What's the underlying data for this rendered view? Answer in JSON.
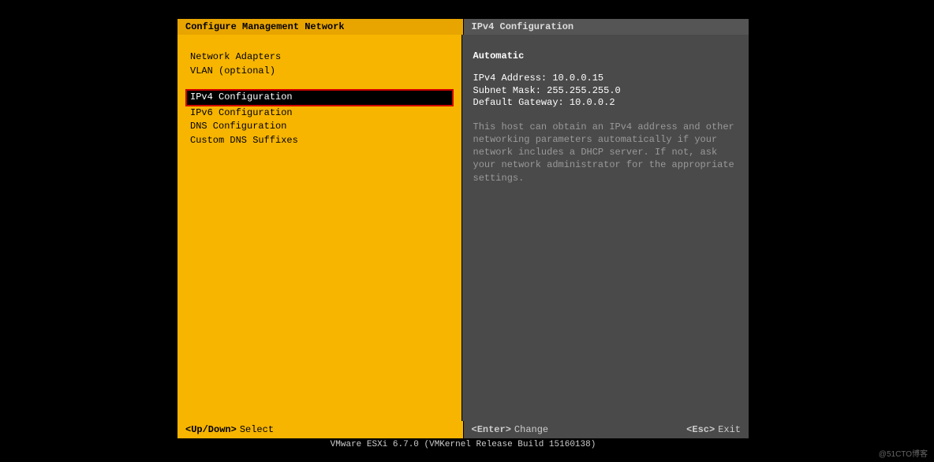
{
  "header": {
    "left": "Configure Management Network",
    "right": "IPv4 Configuration"
  },
  "menu": {
    "group1": [
      "Network Adapters",
      "VLAN (optional)"
    ],
    "group2": [
      "IPv4 Configuration",
      "IPv6 Configuration",
      "DNS Configuration",
      "Custom DNS Suffixes"
    ],
    "selected": "IPv4 Configuration"
  },
  "detail": {
    "title": "Automatic",
    "lines": [
      "IPv4 Address: 10.0.0.15",
      "Subnet Mask: 255.255.255.0",
      "Default Gateway: 10.0.0.2"
    ],
    "description": "This host can obtain an IPv4 address and other networking parameters automatically if your network includes a DHCP server. If not, ask your network administrator for the appropriate settings."
  },
  "footer": {
    "left_key": "<Up/Down>",
    "left_label": "Select",
    "center_key": "<Enter>",
    "center_label": "Change",
    "right_key": "<Esc>",
    "right_label": "Exit"
  },
  "status": "VMware ESXi 6.7.0 (VMKernel Release Build 15160138)",
  "watermark": "@51CTO博客"
}
